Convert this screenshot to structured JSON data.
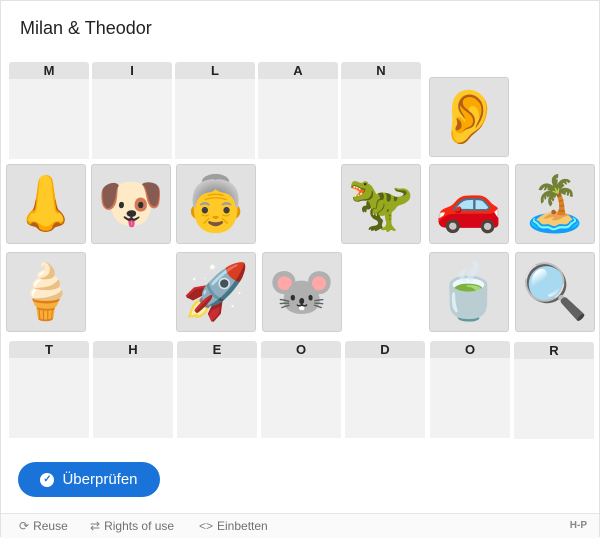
{
  "title": "Milan & Theodor",
  "row1_letters": [
    "M",
    "I",
    "L",
    "A",
    "N"
  ],
  "row2_letters": [
    "T",
    "H",
    "E",
    "O",
    "D",
    "O",
    "R"
  ],
  "tiles": {
    "ear": "👂",
    "nose": "👃",
    "dog": "🐶",
    "grandma": "👵",
    "dinosaur": "🦖",
    "car": "🚗",
    "island": "🏝️",
    "ice_cream": "🍦",
    "rocket": "🚀",
    "mouse": "🐭",
    "tea": "🍵",
    "magnifier": "🔍"
  },
  "check_button": {
    "label": "Überprüfen",
    "icon": "check-circle-icon"
  },
  "footer": {
    "reuse": "Reuse",
    "rights": "Rights of use",
    "embed": "Einbetten",
    "logo": "H-P"
  },
  "colors": {
    "accent": "#1a73d9",
    "tile_bg": "#e1e1e1",
    "slot_bg": "#f2f2f2",
    "header_bg": "#e3e3e3"
  }
}
